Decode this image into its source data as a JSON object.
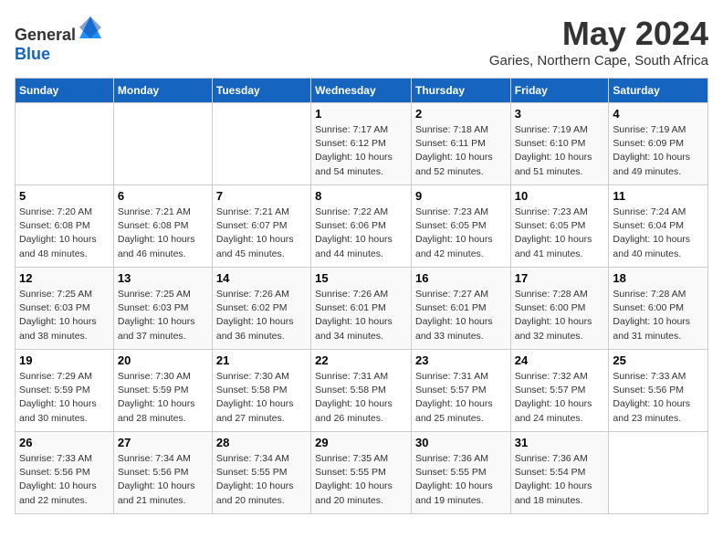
{
  "header": {
    "logo_general": "General",
    "logo_blue": "Blue",
    "month": "May 2024",
    "location": "Garies, Northern Cape, South Africa"
  },
  "weekdays": [
    "Sunday",
    "Monday",
    "Tuesday",
    "Wednesday",
    "Thursday",
    "Friday",
    "Saturday"
  ],
  "weeks": [
    [
      {
        "day": "",
        "info": ""
      },
      {
        "day": "",
        "info": ""
      },
      {
        "day": "",
        "info": ""
      },
      {
        "day": "1",
        "info": "Sunrise: 7:17 AM\nSunset: 6:12 PM\nDaylight: 10 hours\nand 54 minutes."
      },
      {
        "day": "2",
        "info": "Sunrise: 7:18 AM\nSunset: 6:11 PM\nDaylight: 10 hours\nand 52 minutes."
      },
      {
        "day": "3",
        "info": "Sunrise: 7:19 AM\nSunset: 6:10 PM\nDaylight: 10 hours\nand 51 minutes."
      },
      {
        "day": "4",
        "info": "Sunrise: 7:19 AM\nSunset: 6:09 PM\nDaylight: 10 hours\nand 49 minutes."
      }
    ],
    [
      {
        "day": "5",
        "info": "Sunrise: 7:20 AM\nSunset: 6:08 PM\nDaylight: 10 hours\nand 48 minutes."
      },
      {
        "day": "6",
        "info": "Sunrise: 7:21 AM\nSunset: 6:08 PM\nDaylight: 10 hours\nand 46 minutes."
      },
      {
        "day": "7",
        "info": "Sunrise: 7:21 AM\nSunset: 6:07 PM\nDaylight: 10 hours\nand 45 minutes."
      },
      {
        "day": "8",
        "info": "Sunrise: 7:22 AM\nSunset: 6:06 PM\nDaylight: 10 hours\nand 44 minutes."
      },
      {
        "day": "9",
        "info": "Sunrise: 7:23 AM\nSunset: 6:05 PM\nDaylight: 10 hours\nand 42 minutes."
      },
      {
        "day": "10",
        "info": "Sunrise: 7:23 AM\nSunset: 6:05 PM\nDaylight: 10 hours\nand 41 minutes."
      },
      {
        "day": "11",
        "info": "Sunrise: 7:24 AM\nSunset: 6:04 PM\nDaylight: 10 hours\nand 40 minutes."
      }
    ],
    [
      {
        "day": "12",
        "info": "Sunrise: 7:25 AM\nSunset: 6:03 PM\nDaylight: 10 hours\nand 38 minutes."
      },
      {
        "day": "13",
        "info": "Sunrise: 7:25 AM\nSunset: 6:03 PM\nDaylight: 10 hours\nand 37 minutes."
      },
      {
        "day": "14",
        "info": "Sunrise: 7:26 AM\nSunset: 6:02 PM\nDaylight: 10 hours\nand 36 minutes."
      },
      {
        "day": "15",
        "info": "Sunrise: 7:26 AM\nSunset: 6:01 PM\nDaylight: 10 hours\nand 34 minutes."
      },
      {
        "day": "16",
        "info": "Sunrise: 7:27 AM\nSunset: 6:01 PM\nDaylight: 10 hours\nand 33 minutes."
      },
      {
        "day": "17",
        "info": "Sunrise: 7:28 AM\nSunset: 6:00 PM\nDaylight: 10 hours\nand 32 minutes."
      },
      {
        "day": "18",
        "info": "Sunrise: 7:28 AM\nSunset: 6:00 PM\nDaylight: 10 hours\nand 31 minutes."
      }
    ],
    [
      {
        "day": "19",
        "info": "Sunrise: 7:29 AM\nSunset: 5:59 PM\nDaylight: 10 hours\nand 30 minutes."
      },
      {
        "day": "20",
        "info": "Sunrise: 7:30 AM\nSunset: 5:59 PM\nDaylight: 10 hours\nand 28 minutes."
      },
      {
        "day": "21",
        "info": "Sunrise: 7:30 AM\nSunset: 5:58 PM\nDaylight: 10 hours\nand 27 minutes."
      },
      {
        "day": "22",
        "info": "Sunrise: 7:31 AM\nSunset: 5:58 PM\nDaylight: 10 hours\nand 26 minutes."
      },
      {
        "day": "23",
        "info": "Sunrise: 7:31 AM\nSunset: 5:57 PM\nDaylight: 10 hours\nand 25 minutes."
      },
      {
        "day": "24",
        "info": "Sunrise: 7:32 AM\nSunset: 5:57 PM\nDaylight: 10 hours\nand 24 minutes."
      },
      {
        "day": "25",
        "info": "Sunrise: 7:33 AM\nSunset: 5:56 PM\nDaylight: 10 hours\nand 23 minutes."
      }
    ],
    [
      {
        "day": "26",
        "info": "Sunrise: 7:33 AM\nSunset: 5:56 PM\nDaylight: 10 hours\nand 22 minutes."
      },
      {
        "day": "27",
        "info": "Sunrise: 7:34 AM\nSunset: 5:56 PM\nDaylight: 10 hours\nand 21 minutes."
      },
      {
        "day": "28",
        "info": "Sunrise: 7:34 AM\nSunset: 5:55 PM\nDaylight: 10 hours\nand 20 minutes."
      },
      {
        "day": "29",
        "info": "Sunrise: 7:35 AM\nSunset: 5:55 PM\nDaylight: 10 hours\nand 20 minutes."
      },
      {
        "day": "30",
        "info": "Sunrise: 7:36 AM\nSunset: 5:55 PM\nDaylight: 10 hours\nand 19 minutes."
      },
      {
        "day": "31",
        "info": "Sunrise: 7:36 AM\nSunset: 5:54 PM\nDaylight: 10 hours\nand 18 minutes."
      },
      {
        "day": "",
        "info": ""
      }
    ]
  ]
}
